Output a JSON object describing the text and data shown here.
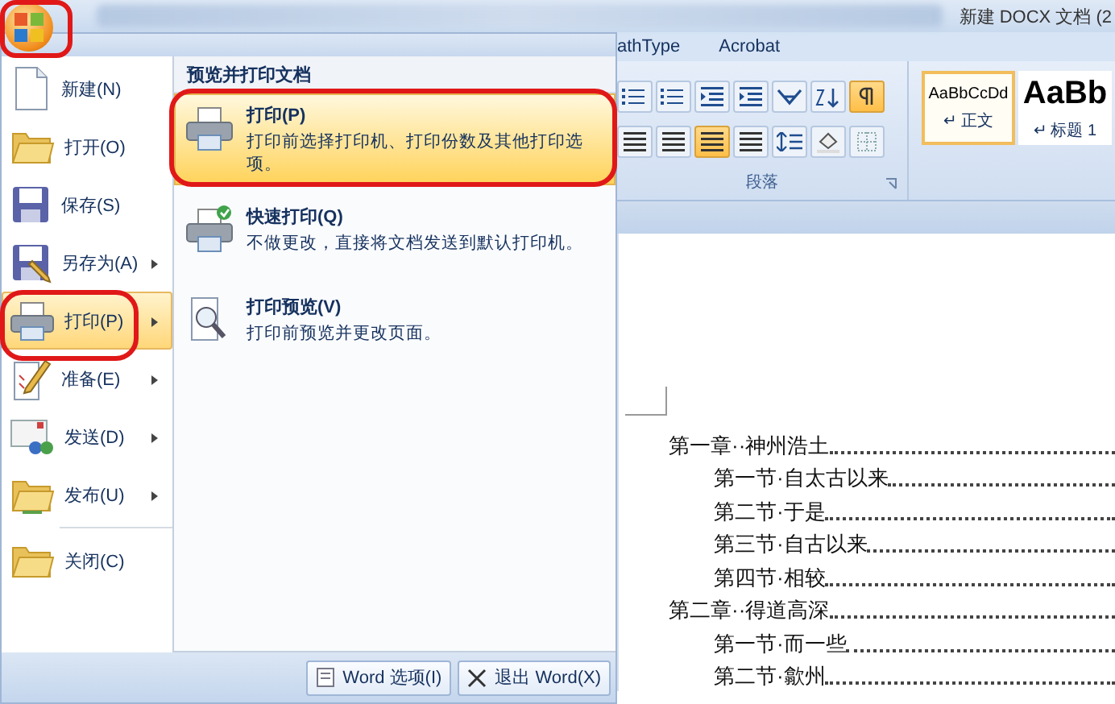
{
  "title_bar": {
    "title": "新建 DOCX 文档 (2"
  },
  "ribbon_tabs": [
    {
      "label": "athType"
    },
    {
      "label": "Acrobat"
    }
  ],
  "ribbon": {
    "paragraph_rows": [
      [
        {
          "kind": "list",
          "selected": false
        },
        {
          "kind": "list",
          "selected": false
        },
        {
          "kind": "indent",
          "selected": false
        },
        {
          "kind": "indent",
          "selected": false
        },
        {
          "kind": "layout",
          "selected": false
        },
        {
          "kind": "sort",
          "selected": false
        },
        {
          "kind": "marks",
          "selected": true
        }
      ],
      [
        {
          "kind": "align",
          "selected": false
        },
        {
          "kind": "align",
          "selected": false
        },
        {
          "kind": "align",
          "selected": true
        },
        {
          "kind": "align",
          "selected": false
        },
        {
          "kind": "spacing",
          "selected": false
        },
        {
          "kind": "shading",
          "selected": false
        },
        {
          "kind": "border",
          "selected": false
        }
      ]
    ],
    "group_label": "段落",
    "styles": [
      {
        "sample": "AaBbCcDd",
        "name": "↵ 正文",
        "selected": true
      },
      {
        "sample": "AaBb",
        "name": "↵ 标题 1",
        "selected": false
      }
    ]
  },
  "office_menu": {
    "items": [
      {
        "label": "新建(N)",
        "kind": "new",
        "submenu": false,
        "selected": false
      },
      {
        "label": "打开(O)",
        "kind": "open",
        "submenu": false,
        "selected": false
      },
      {
        "label": "保存(S)",
        "kind": "save",
        "submenu": false,
        "selected": false
      },
      {
        "label": "另存为(A)",
        "kind": "saveas",
        "submenu": true,
        "selected": false
      },
      {
        "label": "打印(P)",
        "kind": "print",
        "submenu": true,
        "selected": true
      },
      {
        "label": "准备(E)",
        "kind": "prepare",
        "submenu": true,
        "selected": false
      },
      {
        "label": "发送(D)",
        "kind": "send",
        "submenu": true,
        "selected": false
      },
      {
        "label": "发布(U)",
        "kind": "publish",
        "submenu": true,
        "selected": false
      },
      {
        "label": "关闭(C)",
        "kind": "close",
        "submenu": false,
        "selected": false
      }
    ],
    "pane": {
      "title": "预览并打印文档",
      "items": [
        {
          "title": "打印(P)",
          "description": "打印前选择打印机、打印份数及其他打印选项。",
          "kind": "print",
          "selected": true
        },
        {
          "title": "快速打印(Q)",
          "description": "不做更改，直接将文档发送到默认打印机。",
          "kind": "quickprint",
          "selected": false
        },
        {
          "title": "打印预览(V)",
          "description": "打印前预览并更改页面。",
          "kind": "preview",
          "selected": false
        }
      ]
    },
    "buttons": [
      {
        "label": "Word 选项(I)",
        "kind": "options"
      },
      {
        "label": "退出 Word(X)",
        "kind": "exit"
      }
    ]
  },
  "document": {
    "toc": [
      {
        "text": "第一章··神州浩土",
        "children": [
          {
            "text": "第一节·自太古以来"
          },
          {
            "text": "第二节·于是"
          },
          {
            "text": "第三节·自古以来"
          },
          {
            "text": "第四节·相较"
          }
        ]
      },
      {
        "text": "第二章··得道高深",
        "children": [
          {
            "text": "第一节·而一些"
          },
          {
            "text": "第二节·歙州"
          }
        ]
      }
    ]
  }
}
